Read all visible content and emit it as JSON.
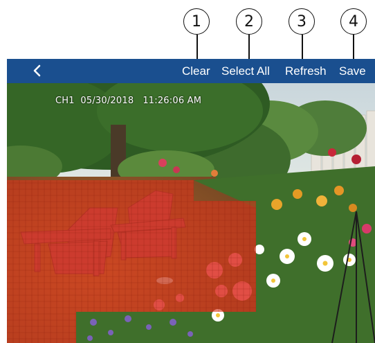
{
  "callouts": [
    "1",
    "2",
    "3",
    "4"
  ],
  "toolbar": {
    "back_icon": "chevron-left-icon",
    "clear_label": "Clear",
    "select_all_label": "Select All",
    "refresh_label": "Refresh",
    "save_label": "Save",
    "background_color": "#1a4f8f"
  },
  "camera": {
    "osd_text": "CH1  05/30/2018   11:26:06 AM",
    "motion_overlay_color": "#d9341b"
  }
}
